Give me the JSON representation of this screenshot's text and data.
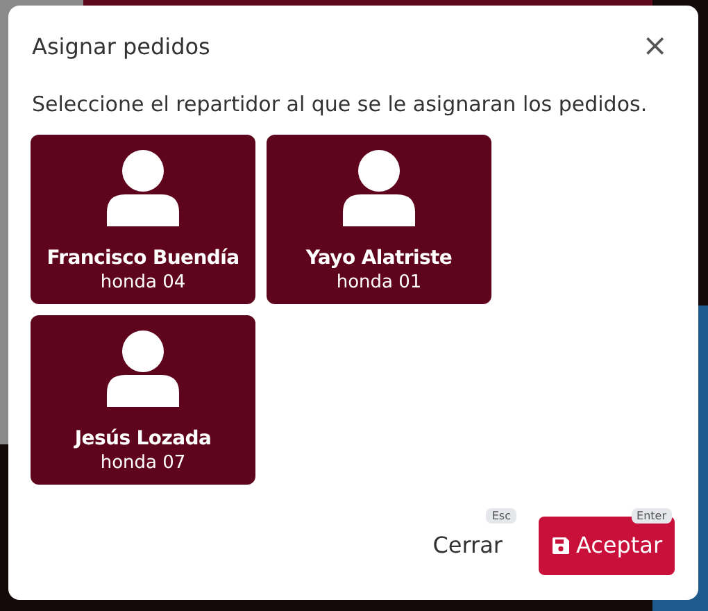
{
  "dialog": {
    "title": "Asignar pedidos",
    "close_label": "×",
    "prompt": "Seleccione el repartidor al que se le asignaran los pedidos."
  },
  "drivers": [
    {
      "name": "Francisco Buendía",
      "vehicle": "honda 04"
    },
    {
      "name": "Yayo Alatriste",
      "vehicle": "honda 01"
    },
    {
      "name": "Jesús Lozada",
      "vehicle": "honda 07"
    }
  ],
  "buttons": [
    {
      "kind": "plain",
      "label": "Cerrar",
      "shortcut": "Esc"
    },
    {
      "kind": "primary",
      "label": "Aceptar",
      "shortcut": "Enter"
    }
  ]
}
